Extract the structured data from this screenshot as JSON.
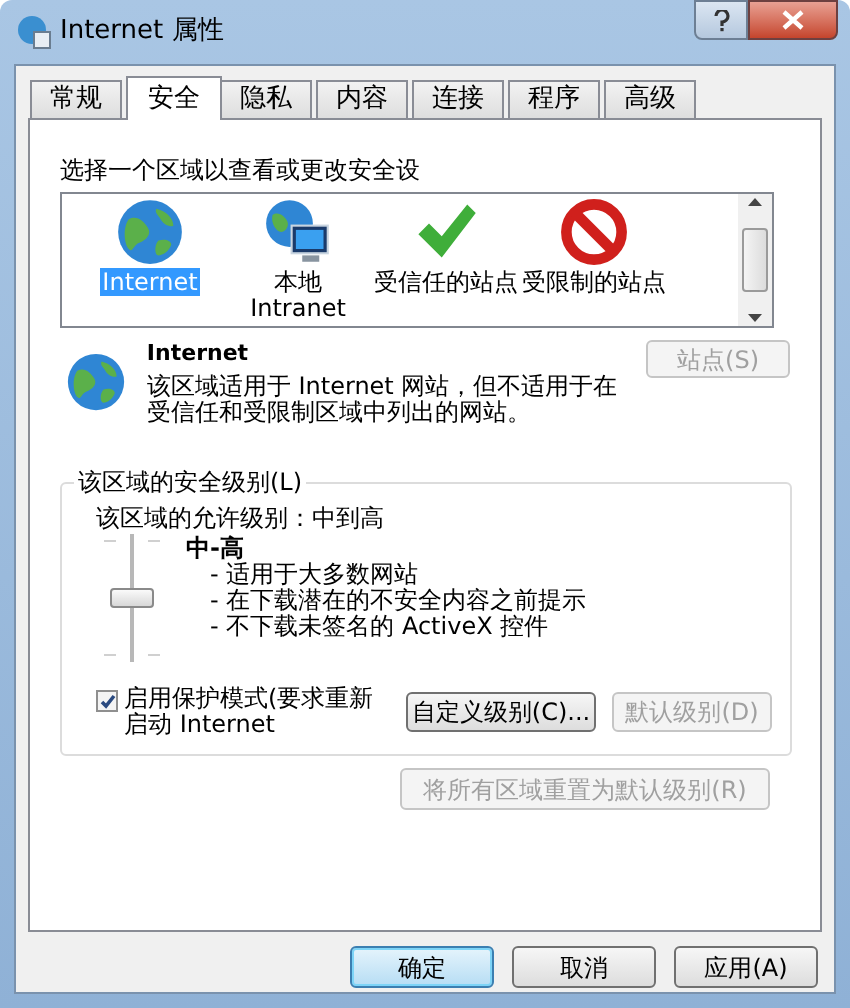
{
  "window": {
    "title": "Internet 属性"
  },
  "tabs": [
    {
      "label": "常规",
      "selected": false
    },
    {
      "label": "安全",
      "selected": true
    },
    {
      "label": "隐私",
      "selected": false
    },
    {
      "label": "内容",
      "selected": false
    },
    {
      "label": "连接",
      "selected": false
    },
    {
      "label": "程序",
      "selected": false
    },
    {
      "label": "高级",
      "selected": false
    }
  ],
  "zone_prompt": "选择一个区域以查看或更改安全设",
  "zones": [
    {
      "kind": "internet",
      "label": "Internet",
      "selected": true
    },
    {
      "kind": "intranet",
      "label": "本地 Intranet",
      "selected": false
    },
    {
      "kind": "trusted",
      "label": "受信任的站点",
      "selected": false
    },
    {
      "kind": "restricted",
      "label": "受限制的站点",
      "selected": false
    }
  ],
  "zone_info": {
    "title": "Internet",
    "description": "该区域适用于 Internet 网站，但不适用于在受信任和受限制区域中列出的网站。",
    "sites_button": {
      "label": "站点(S)",
      "disabled": true
    }
  },
  "security_level": {
    "legend": "该区域的安全级别(L)",
    "allowed": "该区域的允许级别：中到高",
    "slider": {
      "level": 0.5
    },
    "level_name": "中-高",
    "bullets": [
      "- 适用于大多数网站",
      "- 在下载潜在的不安全内容之前提示",
      "- 不下载未签名的 ActiveX 控件"
    ],
    "protected_mode": {
      "label": "启用保护模式(要求重新启动 Internet",
      "checked": true
    },
    "buttons": [
      {
        "label": "自定义级别(C)...",
        "disabled": false
      },
      {
        "label": "默认级别(D)",
        "disabled": true
      }
    ]
  },
  "reset_button": {
    "label": "将所有区域重置为默认级别(R)",
    "disabled": true
  },
  "footer_buttons": [
    {
      "label": "确定",
      "default": true
    },
    {
      "label": "取消",
      "default": false
    },
    {
      "label": "应用(A)",
      "default": false
    }
  ]
}
